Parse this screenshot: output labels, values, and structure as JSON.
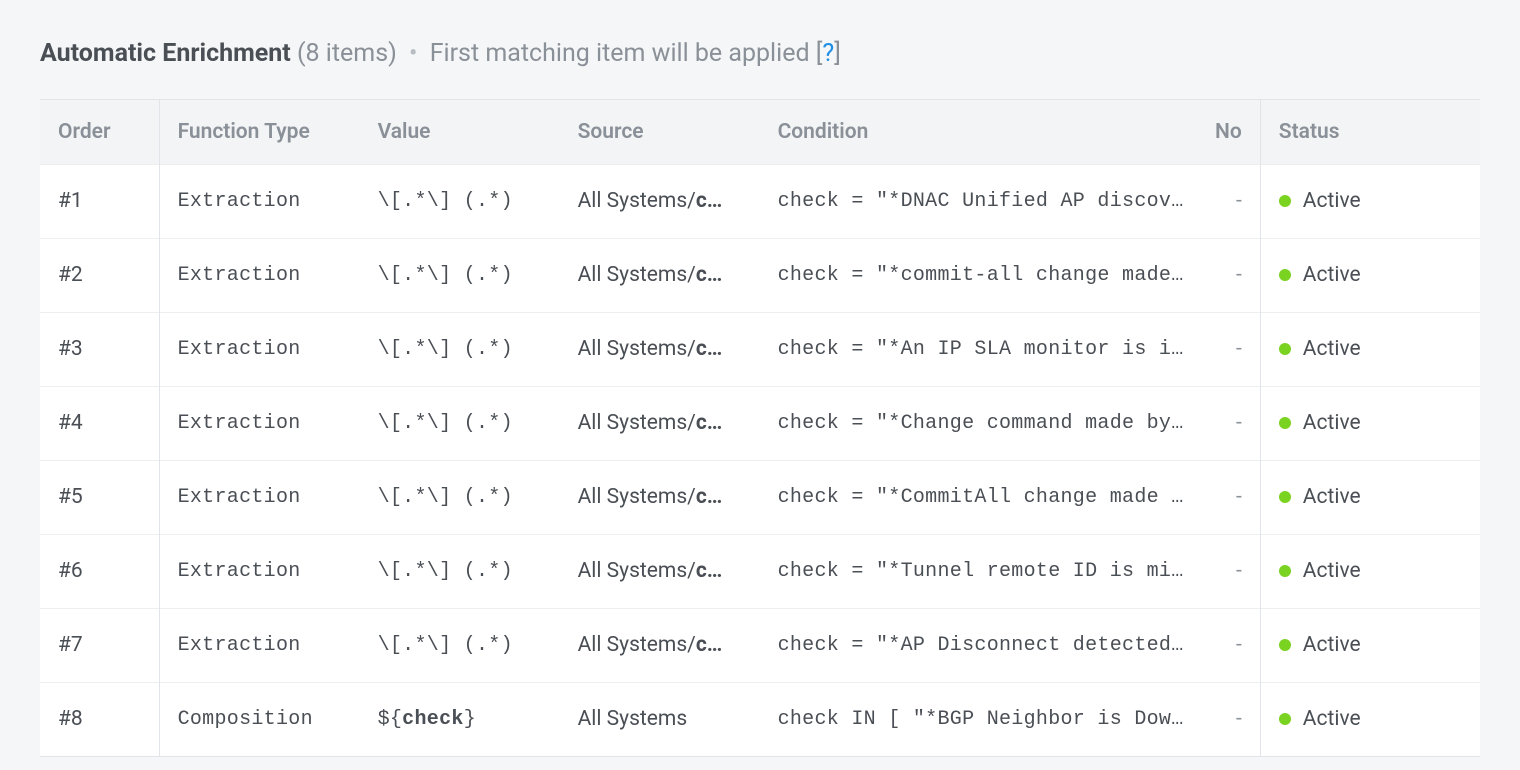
{
  "heading": {
    "title": "Automatic Enrichment",
    "count": "8 items",
    "note": "First matching item will be applied ",
    "help": "?"
  },
  "columns": {
    "order": "Order",
    "function_type": "Function Type",
    "value": "Value",
    "source": "Source",
    "condition": "Condition",
    "note": "No",
    "status": "Status"
  },
  "status_color": "#7bd321",
  "rows": [
    {
      "order": "#1",
      "function_type": "Extraction",
      "value_pre": "\\[.*\\] (.*)",
      "value_bold": "",
      "value_post": "",
      "source_pre": "All Systems/",
      "source_bold": "c…",
      "condition": "check = \"*DNAC Unified AP discove…",
      "note": "-",
      "status": "Active"
    },
    {
      "order": "#2",
      "function_type": "Extraction",
      "value_pre": "\\[.*\\] (.*)",
      "value_bold": "",
      "value_post": "",
      "source_pre": "All Systems/",
      "source_bold": "c…",
      "condition": "check = \"*commit-all change made …",
      "note": "-",
      "status": "Active"
    },
    {
      "order": "#3",
      "function_type": "Extraction",
      "value_pre": "\\[.*\\] (.*)",
      "value_bold": "",
      "value_post": "",
      "source_pre": "All Systems/",
      "source_bold": "c…",
      "condition": "check = \"*An IP SLA monitor is in…",
      "note": "-",
      "status": "Active"
    },
    {
      "order": "#4",
      "function_type": "Extraction",
      "value_pre": "\\[.*\\] (.*)",
      "value_bold": "",
      "value_post": "",
      "source_pre": "All Systems/",
      "source_bold": "c…",
      "condition": "check = \"*Change command made by*\"",
      "note": "-",
      "status": "Active"
    },
    {
      "order": "#5",
      "function_type": "Extraction",
      "value_pre": "\\[.*\\] (.*)",
      "value_bold": "",
      "value_post": "",
      "source_pre": "All Systems/",
      "source_bold": "c…",
      "condition": "check = \"*CommitAll change made b…",
      "note": "-",
      "status": "Active"
    },
    {
      "order": "#6",
      "function_type": "Extraction",
      "value_pre": "\\[.*\\] (.*)",
      "value_bold": "",
      "value_post": "",
      "source_pre": "All Systems/",
      "source_bold": "c…",
      "condition": "check = \"*Tunnel remote ID is mis…",
      "note": "-",
      "status": "Active"
    },
    {
      "order": "#7",
      "function_type": "Extraction",
      "value_pre": "\\[.*\\] (.*)",
      "value_bold": "",
      "value_post": "",
      "source_pre": "All Systems/",
      "source_bold": "c…",
      "condition": "check = \"*AP Disconnect detected*\"",
      "note": "-",
      "status": "Active"
    },
    {
      "order": "#8",
      "function_type": "Composition",
      "value_pre": "${",
      "value_bold": "check",
      "value_post": "}",
      "source_pre": "All Systems",
      "source_bold": "",
      "condition": "check IN [ \"*BGP Neighbor is Down…",
      "note": "-",
      "status": "Active"
    }
  ]
}
